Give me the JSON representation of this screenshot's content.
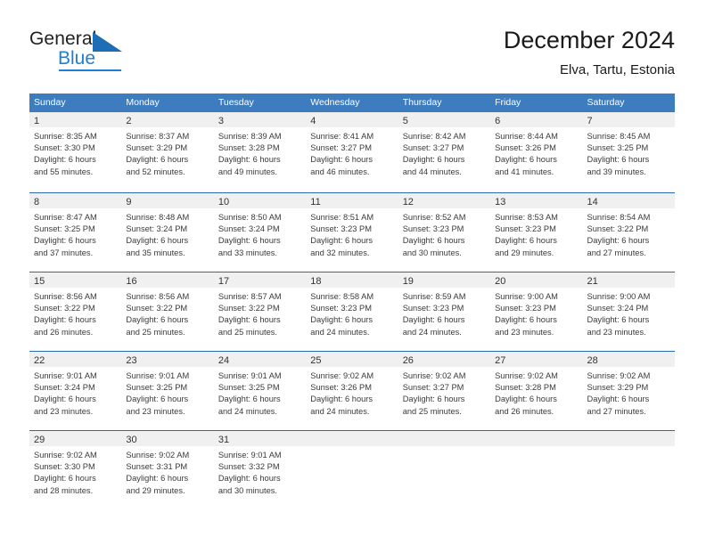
{
  "brand": {
    "name_part1": "General",
    "name_part2": "Blue",
    "triangle_color": "#1f6db4",
    "blue_color": "#1f7fd4"
  },
  "header": {
    "title": "December 2024",
    "subtitle": "Elva, Tartu, Estonia"
  },
  "theme": {
    "header_bg": "#3c7cbf",
    "row_line": "#2a6ab0",
    "daynum_band": "#f0f0f0"
  },
  "weekdays": [
    "Sunday",
    "Monday",
    "Tuesday",
    "Wednesday",
    "Thursday",
    "Friday",
    "Saturday"
  ],
  "weeks": [
    [
      {
        "day": "1",
        "sunrise": "Sunrise: 8:35 AM",
        "sunset": "Sunset: 3:30 PM",
        "daylight1": "Daylight: 6 hours",
        "daylight2": "and 55 minutes."
      },
      {
        "day": "2",
        "sunrise": "Sunrise: 8:37 AM",
        "sunset": "Sunset: 3:29 PM",
        "daylight1": "Daylight: 6 hours",
        "daylight2": "and 52 minutes."
      },
      {
        "day": "3",
        "sunrise": "Sunrise: 8:39 AM",
        "sunset": "Sunset: 3:28 PM",
        "daylight1": "Daylight: 6 hours",
        "daylight2": "and 49 minutes."
      },
      {
        "day": "4",
        "sunrise": "Sunrise: 8:41 AM",
        "sunset": "Sunset: 3:27 PM",
        "daylight1": "Daylight: 6 hours",
        "daylight2": "and 46 minutes."
      },
      {
        "day": "5",
        "sunrise": "Sunrise: 8:42 AM",
        "sunset": "Sunset: 3:27 PM",
        "daylight1": "Daylight: 6 hours",
        "daylight2": "and 44 minutes."
      },
      {
        "day": "6",
        "sunrise": "Sunrise: 8:44 AM",
        "sunset": "Sunset: 3:26 PM",
        "daylight1": "Daylight: 6 hours",
        "daylight2": "and 41 minutes."
      },
      {
        "day": "7",
        "sunrise": "Sunrise: 8:45 AM",
        "sunset": "Sunset: 3:25 PM",
        "daylight1": "Daylight: 6 hours",
        "daylight2": "and 39 minutes."
      }
    ],
    [
      {
        "day": "8",
        "sunrise": "Sunrise: 8:47 AM",
        "sunset": "Sunset: 3:25 PM",
        "daylight1": "Daylight: 6 hours",
        "daylight2": "and 37 minutes."
      },
      {
        "day": "9",
        "sunrise": "Sunrise: 8:48 AM",
        "sunset": "Sunset: 3:24 PM",
        "daylight1": "Daylight: 6 hours",
        "daylight2": "and 35 minutes."
      },
      {
        "day": "10",
        "sunrise": "Sunrise: 8:50 AM",
        "sunset": "Sunset: 3:24 PM",
        "daylight1": "Daylight: 6 hours",
        "daylight2": "and 33 minutes."
      },
      {
        "day": "11",
        "sunrise": "Sunrise: 8:51 AM",
        "sunset": "Sunset: 3:23 PM",
        "daylight1": "Daylight: 6 hours",
        "daylight2": "and 32 minutes."
      },
      {
        "day": "12",
        "sunrise": "Sunrise: 8:52 AM",
        "sunset": "Sunset: 3:23 PM",
        "daylight1": "Daylight: 6 hours",
        "daylight2": "and 30 minutes."
      },
      {
        "day": "13",
        "sunrise": "Sunrise: 8:53 AM",
        "sunset": "Sunset: 3:23 PM",
        "daylight1": "Daylight: 6 hours",
        "daylight2": "and 29 minutes."
      },
      {
        "day": "14",
        "sunrise": "Sunrise: 8:54 AM",
        "sunset": "Sunset: 3:22 PM",
        "daylight1": "Daylight: 6 hours",
        "daylight2": "and 27 minutes."
      }
    ],
    [
      {
        "day": "15",
        "sunrise": "Sunrise: 8:56 AM",
        "sunset": "Sunset: 3:22 PM",
        "daylight1": "Daylight: 6 hours",
        "daylight2": "and 26 minutes."
      },
      {
        "day": "16",
        "sunrise": "Sunrise: 8:56 AM",
        "sunset": "Sunset: 3:22 PM",
        "daylight1": "Daylight: 6 hours",
        "daylight2": "and 25 minutes."
      },
      {
        "day": "17",
        "sunrise": "Sunrise: 8:57 AM",
        "sunset": "Sunset: 3:22 PM",
        "daylight1": "Daylight: 6 hours",
        "daylight2": "and 25 minutes."
      },
      {
        "day": "18",
        "sunrise": "Sunrise: 8:58 AM",
        "sunset": "Sunset: 3:23 PM",
        "daylight1": "Daylight: 6 hours",
        "daylight2": "and 24 minutes."
      },
      {
        "day": "19",
        "sunrise": "Sunrise: 8:59 AM",
        "sunset": "Sunset: 3:23 PM",
        "daylight1": "Daylight: 6 hours",
        "daylight2": "and 24 minutes."
      },
      {
        "day": "20",
        "sunrise": "Sunrise: 9:00 AM",
        "sunset": "Sunset: 3:23 PM",
        "daylight1": "Daylight: 6 hours",
        "daylight2": "and 23 minutes."
      },
      {
        "day": "21",
        "sunrise": "Sunrise: 9:00 AM",
        "sunset": "Sunset: 3:24 PM",
        "daylight1": "Daylight: 6 hours",
        "daylight2": "and 23 minutes."
      }
    ],
    [
      {
        "day": "22",
        "sunrise": "Sunrise: 9:01 AM",
        "sunset": "Sunset: 3:24 PM",
        "daylight1": "Daylight: 6 hours",
        "daylight2": "and 23 minutes."
      },
      {
        "day": "23",
        "sunrise": "Sunrise: 9:01 AM",
        "sunset": "Sunset: 3:25 PM",
        "daylight1": "Daylight: 6 hours",
        "daylight2": "and 23 minutes."
      },
      {
        "day": "24",
        "sunrise": "Sunrise: 9:01 AM",
        "sunset": "Sunset: 3:25 PM",
        "daylight1": "Daylight: 6 hours",
        "daylight2": "and 24 minutes."
      },
      {
        "day": "25",
        "sunrise": "Sunrise: 9:02 AM",
        "sunset": "Sunset: 3:26 PM",
        "daylight1": "Daylight: 6 hours",
        "daylight2": "and 24 minutes."
      },
      {
        "day": "26",
        "sunrise": "Sunrise: 9:02 AM",
        "sunset": "Sunset: 3:27 PM",
        "daylight1": "Daylight: 6 hours",
        "daylight2": "and 25 minutes."
      },
      {
        "day": "27",
        "sunrise": "Sunrise: 9:02 AM",
        "sunset": "Sunset: 3:28 PM",
        "daylight1": "Daylight: 6 hours",
        "daylight2": "and 26 minutes."
      },
      {
        "day": "28",
        "sunrise": "Sunrise: 9:02 AM",
        "sunset": "Sunset: 3:29 PM",
        "daylight1": "Daylight: 6 hours",
        "daylight2": "and 27 minutes."
      }
    ],
    [
      {
        "day": "29",
        "sunrise": "Sunrise: 9:02 AM",
        "sunset": "Sunset: 3:30 PM",
        "daylight1": "Daylight: 6 hours",
        "daylight2": "and 28 minutes."
      },
      {
        "day": "30",
        "sunrise": "Sunrise: 9:02 AM",
        "sunset": "Sunset: 3:31 PM",
        "daylight1": "Daylight: 6 hours",
        "daylight2": "and 29 minutes."
      },
      {
        "day": "31",
        "sunrise": "Sunrise: 9:01 AM",
        "sunset": "Sunset: 3:32 PM",
        "daylight1": "Daylight: 6 hours",
        "daylight2": "and 30 minutes."
      },
      {
        "day": "",
        "sunrise": "",
        "sunset": "",
        "daylight1": "",
        "daylight2": ""
      },
      {
        "day": "",
        "sunrise": "",
        "sunset": "",
        "daylight1": "",
        "daylight2": ""
      },
      {
        "day": "",
        "sunrise": "",
        "sunset": "",
        "daylight1": "",
        "daylight2": ""
      },
      {
        "day": "",
        "sunrise": "",
        "sunset": "",
        "daylight1": "",
        "daylight2": ""
      }
    ]
  ]
}
